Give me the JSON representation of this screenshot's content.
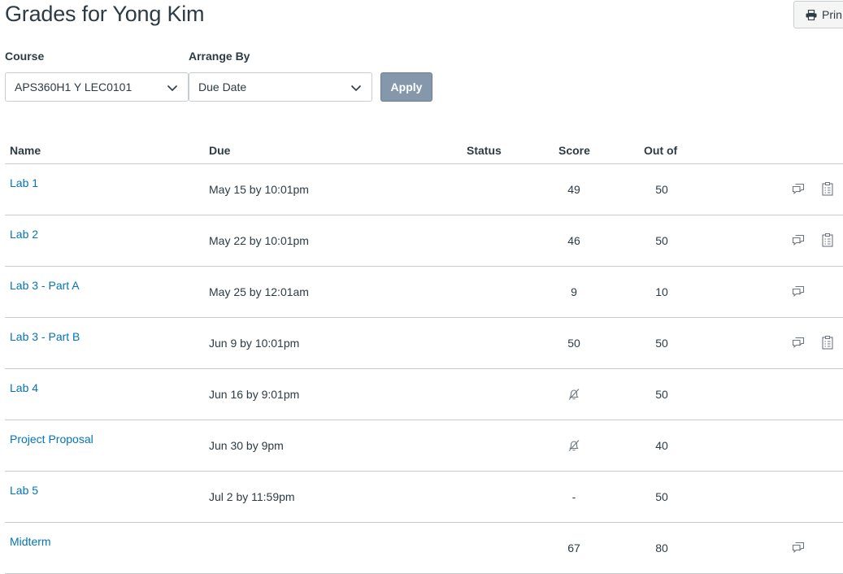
{
  "page": {
    "title": "Grades for Yong Kim",
    "print_label": "Prin"
  },
  "filters": {
    "course_label": "Course",
    "course_value": "APS360H1 Y LEC0101",
    "arrange_label": "Arrange By",
    "arrange_value": "Due Date",
    "apply_label": "Apply"
  },
  "table": {
    "headers": {
      "name": "Name",
      "due": "Due",
      "status": "Status",
      "score": "Score",
      "out_of": "Out of"
    },
    "rows": [
      {
        "name": "Lab 1",
        "due": "May 15 by 10:01pm",
        "score": "49",
        "out_of": "50",
        "icons": [
          "comment-icon",
          "rubric-icon"
        ]
      },
      {
        "name": "Lab 2",
        "due": "May 22 by 10:01pm",
        "score": "46",
        "out_of": "50",
        "icons": [
          "comment-icon",
          "rubric-icon"
        ]
      },
      {
        "name": "Lab 3 - Part A",
        "due": "May 25 by 12:01am",
        "score": "9",
        "out_of": "10",
        "icons": [
          "comment-icon"
        ]
      },
      {
        "name": "Lab 3 - Part B",
        "due": "Jun 9 by 10:01pm",
        "score": "50",
        "out_of": "50",
        "icons": [
          "comment-icon",
          "rubric-icon"
        ]
      },
      {
        "name": "Lab 4",
        "due": "Jun 16 by 9:01pm",
        "score": "",
        "score_icon": "muted-bell-icon",
        "out_of": "50",
        "icons": []
      },
      {
        "name": "Project Proposal",
        "due": "Jun 30 by 9pm",
        "score": "",
        "score_icon": "muted-bell-icon",
        "out_of": "40",
        "icons": []
      },
      {
        "name": "Lab 5",
        "due": "Jul 2 by 11:59pm",
        "score": "-",
        "out_of": "50",
        "icons": []
      },
      {
        "name": "Midterm",
        "due": "",
        "score": "67",
        "out_of": "80",
        "icons": [
          "comment-icon"
        ]
      }
    ]
  },
  "colors": {
    "link": "#0374b5",
    "text": "#2d3b45",
    "border": "#c7cdd1",
    "apply_button": "#8597ab"
  }
}
